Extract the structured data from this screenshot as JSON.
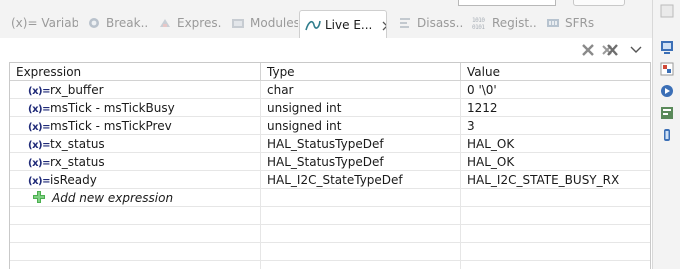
{
  "tabs": [
    {
      "label": "(x)= Variabl...",
      "icon": "variables-icon"
    },
    {
      "label": "Break...",
      "icon": "breakpoints-icon"
    },
    {
      "label": "Expres...",
      "icon": "expressions-icon"
    },
    {
      "label": "Modules",
      "icon": "modules-icon"
    },
    {
      "label": "Live E...",
      "icon": "live-expressions-icon",
      "active": true
    },
    {
      "label": "Disass...",
      "icon": "disassembly-icon"
    },
    {
      "label": "Regist...",
      "icon": "registers-icon",
      "glyph": "1010\n0101"
    },
    {
      "label": "SFRs",
      "icon": "sfrs-icon"
    }
  ],
  "table": {
    "columns": [
      "Expression",
      "Type",
      "Value"
    ],
    "rows": [
      {
        "expression": "rx_buffer",
        "type": "char",
        "value": "0 '\\0'"
      },
      {
        "expression": "msTick - msTickBusy",
        "type": "unsigned int",
        "value": "1212"
      },
      {
        "expression": "msTick - msTickPrev",
        "type": "unsigned int",
        "value": "3"
      },
      {
        "expression": "tx_status",
        "type": "HAL_StatusTypeDef",
        "value": "HAL_OK"
      },
      {
        "expression": "rx_status",
        "type": "HAL_StatusTypeDef",
        "value": "HAL_OK"
      },
      {
        "expression": "isReady",
        "type": "HAL_I2C_StateTypeDef",
        "value": "HAL_I2C_STATE_BUSY_RX"
      }
    ],
    "var_icon_text": "(x)=",
    "add_expression_label": "Add new expression"
  },
  "colors": {
    "accent_blue": "#1f2a78",
    "add_green": "#4caf50",
    "remove_gray": "#8a8a8a"
  }
}
